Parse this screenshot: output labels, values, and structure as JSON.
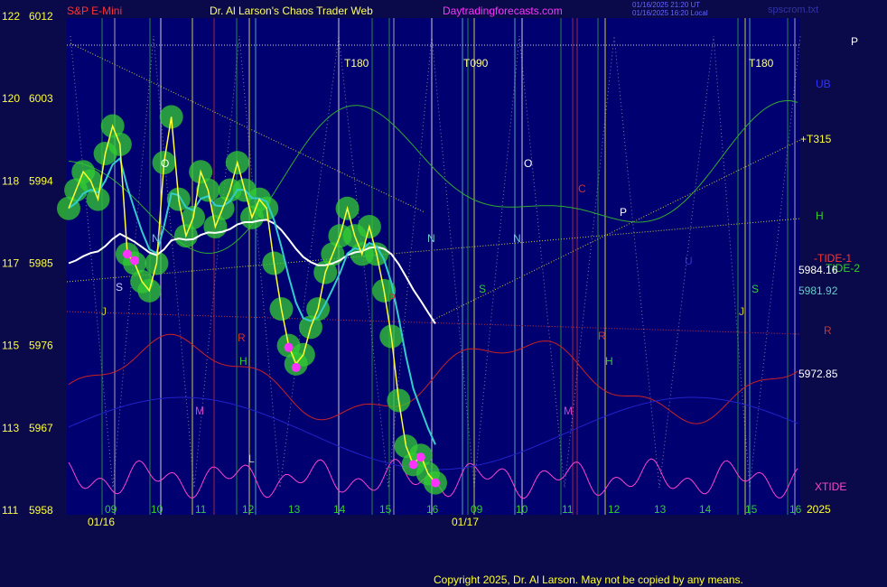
{
  "header": {
    "title": "S&P E-Mini",
    "author": "Dr. Al Larson's Chaos Trader Web",
    "site": "Daytradingforecasts.com",
    "stamp1": "01/16/2025 21:20 UT",
    "stamp2": "01/16/2025 16:20 Local",
    "file": "spscrom.txt"
  },
  "footer": {
    "copyright": "Copyright 2025, Dr. Al Larson. May not be copied by any means."
  },
  "colors": {
    "background": "#0a0a4a",
    "plot_bg": "#000066",
    "price": "#ffff33",
    "ema_fast": "#33cccc",
    "ema_slow": "#ffffff",
    "bubble": "#33cc33",
    "marker": "#ff33ff"
  },
  "chart_data": {
    "type": "line",
    "title": "S&P E-Mini",
    "y_left_outer_ticks": [
      "122",
      "120",
      "118",
      "117",
      "115",
      "113",
      "111"
    ],
    "y_left_inner_ticks": [
      "6012",
      "6003",
      "5994",
      "5985",
      "5976",
      "5967",
      "5958"
    ],
    "ylim": [
      5958,
      6012
    ],
    "x_hour_ticks": [
      "09",
      "10",
      "11",
      "12",
      "13",
      "14",
      "15",
      "16",
      "09",
      "10",
      "11",
      "12",
      "13",
      "14",
      "15",
      "16"
    ],
    "x_dates": [
      "01/16",
      "01/17"
    ],
    "x_year_label": "2025",
    "price_labels": [
      "5984.16",
      "5981.92",
      "5972.85"
    ],
    "right_labels": [
      "P",
      "UB",
      "+T315",
      "H",
      "-TIDE-1",
      "TIDE-2",
      "R",
      "XTIDE"
    ],
    "time_markers": [
      "T180",
      "T090",
      "T180"
    ],
    "planet_letters": [
      "O",
      "O",
      "N",
      "N",
      "N",
      "S",
      "S",
      "S",
      "J",
      "J",
      "R",
      "R",
      "H",
      "H",
      "M",
      "M",
      "C",
      "P",
      "P",
      "U",
      "L"
    ],
    "series": [
      {
        "name": "",
        "x": [
          0,
          2,
          4,
          6,
          8,
          10,
          12,
          14,
          16,
          18,
          20,
          22,
          24,
          26,
          28,
          30,
          32,
          34,
          36,
          38,
          40,
          42,
          44,
          46,
          48,
          50,
          52,
          54,
          56,
          58,
          60,
          62,
          64,
          66,
          68,
          70,
          72,
          74,
          76,
          78,
          80,
          82,
          84,
          86,
          88,
          90,
          92,
          94,
          96,
          98,
          100
        ],
        "values": [
          5991,
          5993,
          5995,
          5994,
          5992,
          5997,
          6000,
          5998,
          5986,
          5985,
          5983,
          5982,
          5985,
          5996,
          6001,
          5992,
          5988,
          5990,
          5995,
          5993,
          5989,
          5991,
          5993,
          5996,
          5993,
          5990,
          5992,
          5991,
          5985,
          5980,
          5976,
          5974,
          5975,
          5978,
          5980,
          5984,
          5986,
          5988,
          5991,
          5988,
          5986,
          5989,
          5986,
          5982,
          5977,
          5970,
          5965,
          5963,
          5964,
          5962,
          5961
        ]
      }
    ]
  }
}
